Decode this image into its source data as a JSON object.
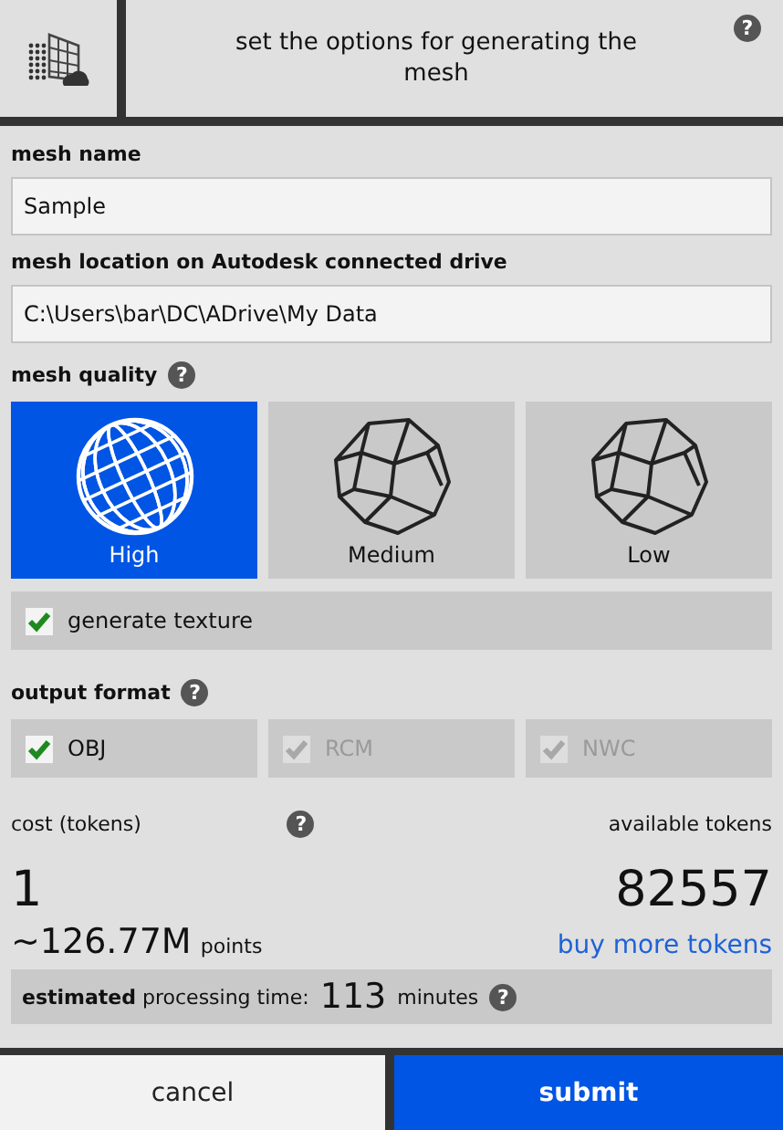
{
  "header": {
    "title": "set the options for generating the mesh",
    "help": "?"
  },
  "mesh_name": {
    "label": "mesh name",
    "value": "Sample"
  },
  "mesh_location": {
    "label": "mesh location on Autodesk connected drive",
    "value": "C:\\Users\\bar\\DC\\ADrive\\My Data"
  },
  "mesh_quality": {
    "label": "mesh quality",
    "help": "?",
    "options": [
      {
        "label": "High",
        "selected": true,
        "kind": "sphere"
      },
      {
        "label": "Medium",
        "selected": false,
        "kind": "polyhedron"
      },
      {
        "label": "Low",
        "selected": false,
        "kind": "polyhedron"
      }
    ]
  },
  "generate_texture": {
    "label": "generate texture",
    "checked": true
  },
  "output_format": {
    "label": "output format",
    "help": "?",
    "options": [
      {
        "label": "OBJ",
        "checked": true,
        "disabled": false
      },
      {
        "label": "RCM",
        "checked": true,
        "disabled": true
      },
      {
        "label": "NWC",
        "checked": true,
        "disabled": true
      }
    ]
  },
  "cost": {
    "label": "cost (tokens)",
    "help": "?",
    "value": "1",
    "points": "~126.77M",
    "points_unit": "points"
  },
  "available": {
    "label": "available tokens",
    "value": "82557",
    "link": "buy more tokens"
  },
  "estimate": {
    "label": "**estimated** processing time:",
    "value": "113",
    "unit": "minutes",
    "help": "?"
  },
  "buttons": [
    {
      "label": "cancel",
      "kind": "secondary"
    },
    {
      "label": "submit",
      "kind": "primary"
    }
  ]
}
